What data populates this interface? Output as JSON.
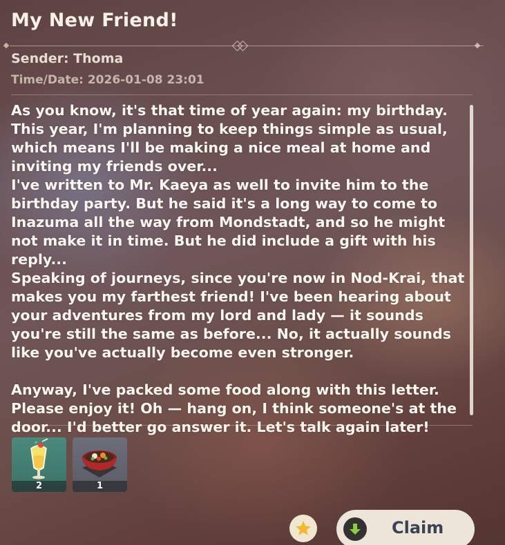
{
  "mail": {
    "title": "My New Friend!",
    "sender": "Sender: Thoma",
    "timedate": "Time/Date: 2026-01-08 23:01",
    "body": "As you know, it's that time of year again: my birthday. This year, I'm planning to keep things simple as usual, which means I'll be making a nice meal at home and inviting my friends over...\nI've written to Mr. Kaeya as well to invite him to the birthday party. But he said it's a long way to come to Inazuma all the way from Mondstadt, and so he might not make it in time. But he did include a gift with his reply...\nSpeaking of journeys, since you're now in Nod-Krai, that makes you my farthest friend! I've been hearing about your adventures from my lord and lady — it sounds you're still the same as before... No, it actually sounds like you've actually become even stronger.\n\nAnyway, I've packed some food along with this letter. Please enjoy it! Oh — hang on, I think someone's at the door... I'd better go answer it. Let's talk again later!"
  },
  "attachments": [
    {
      "icon": "drink-icon",
      "count": "2",
      "rarity_color": "#4a8a7c"
    },
    {
      "icon": "hotpot-dish-icon",
      "count": "1",
      "rarity_color": "#6c6f7a"
    }
  ],
  "actions": {
    "favorite_icon": "star-icon",
    "claim_label": "Claim",
    "claim_icon": "download-arrow-icon"
  },
  "colors": {
    "claim_button_bg": "#ece5d8",
    "claim_icon_arrow": "#8ccf3a",
    "star": "#f2b930"
  }
}
